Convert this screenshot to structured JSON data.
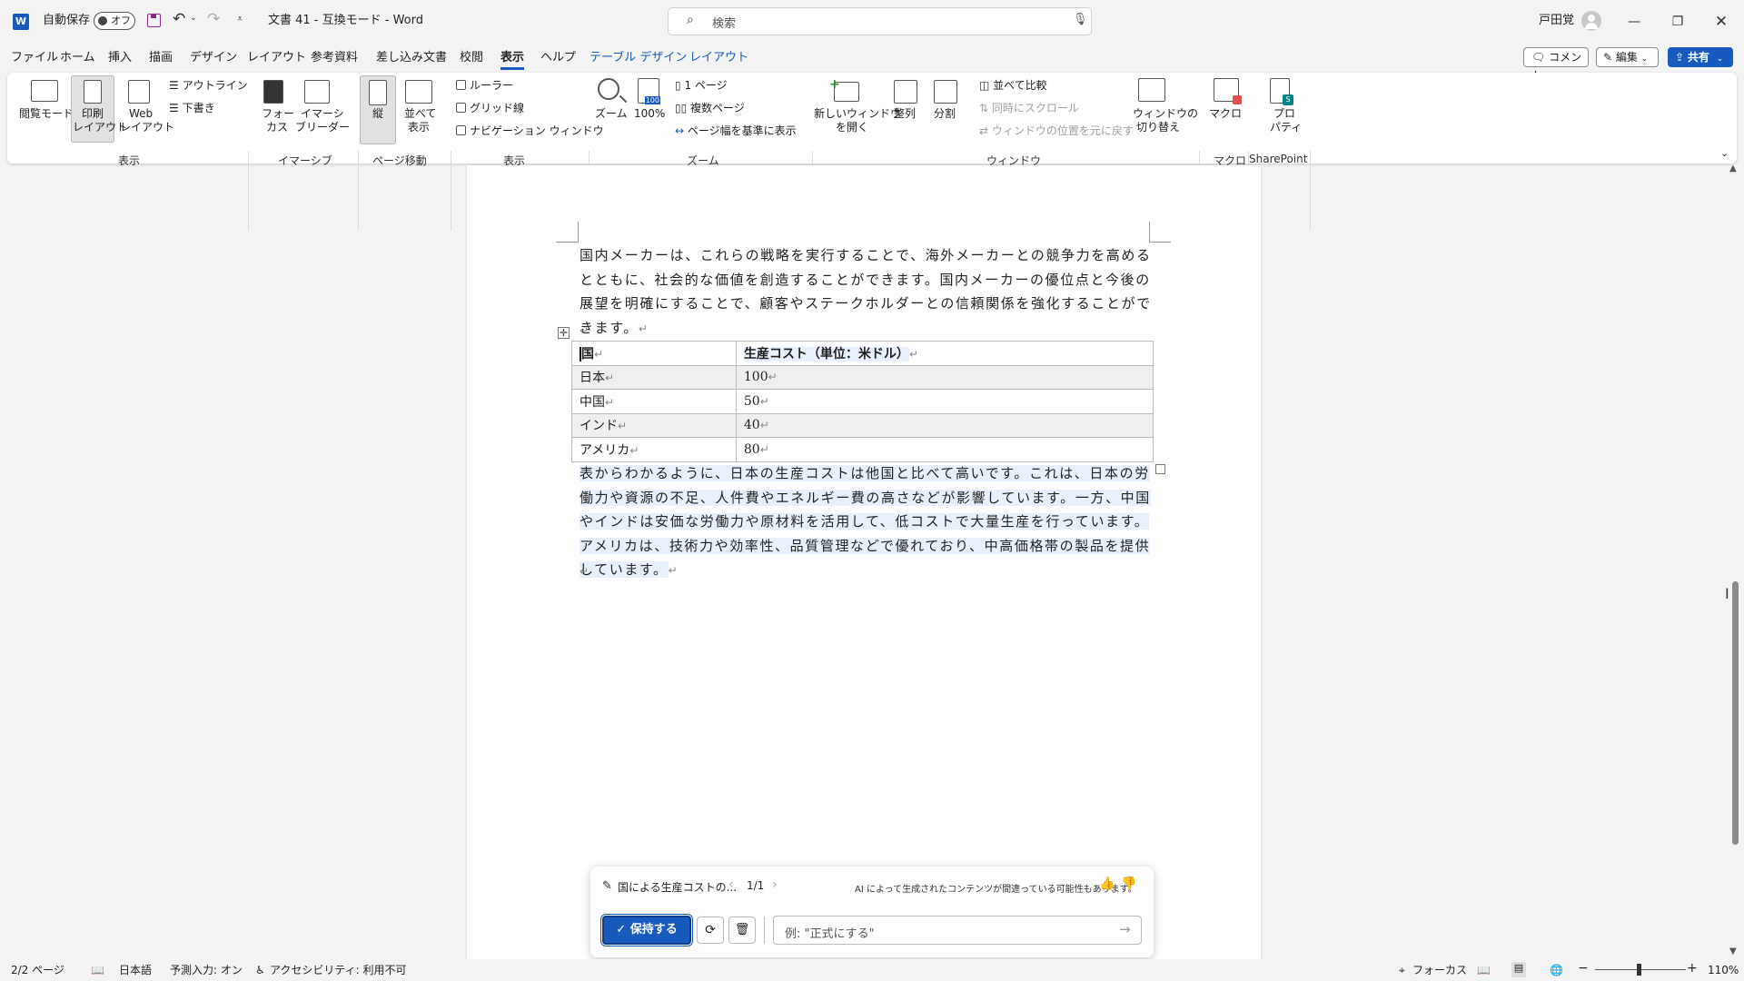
{
  "titlebar": {
    "autosave_label": "自動保存",
    "autosave_state": "オフ",
    "doc_title": "文書 41 - 互換モード - Word",
    "search_placeholder": "検索",
    "user_name": "戸田覚"
  },
  "menu": {
    "tabs": [
      "ファイル",
      "ホーム",
      "挿入",
      "描画",
      "デザイン",
      "レイアウト",
      "参考資料",
      "差し込み文書",
      "校閲",
      "表示",
      "ヘルプ",
      "テーブル デザイン",
      "レイアウト"
    ],
    "selected": "表示",
    "comment_label": "コメント",
    "edit_label": "編集",
    "share_label": "共有"
  },
  "ribbon": {
    "view_group": {
      "read_mode": "閲覧モード",
      "print_layout_1": "印刷",
      "print_layout_2": "レイアウト",
      "web_layout_1": "Web",
      "web_layout_2": "レイアウト",
      "outline": "アウトライン",
      "draft": "下書き",
      "label": "表示"
    },
    "immersive_group": {
      "focus_1": "フォー",
      "focus_2": "カス",
      "reader_1": "イマーシ",
      "reader_2": "ブリーダー",
      "label": "イマーシブ"
    },
    "page_move_group": {
      "vertical": "縦",
      "side_1": "並べて",
      "side_2": "表示",
      "label": "ページ移動"
    },
    "show_group": {
      "ruler": "ルーラー",
      "gridlines": "グリッド線",
      "nav_pane": "ナビゲーション ウィンドウ",
      "label": "表示"
    },
    "zoom_group": {
      "zoom": "ズーム",
      "zoom100": "100%",
      "one_page": "1 ページ",
      "multi_page": "複数ページ",
      "page_width": "ページ幅を基準に表示",
      "label": "ズーム"
    },
    "window_group": {
      "new_window_1": "新しいウィンドウ",
      "new_window_2": "を開く",
      "arrange": "整列",
      "split": "分割",
      "side_by_side": "並べて比較",
      "sync_scroll": "同時にスクロール",
      "reset_pos": "ウィンドウの位置を元に戻す",
      "switch_1": "ウィンドウの",
      "switch_2": "切り替え",
      "label": "ウィンドウ"
    },
    "macro_group": {
      "macro": "マクロ",
      "label": "マクロ"
    },
    "sharepoint_group": {
      "props_1": "プロ",
      "props_2": "パティ",
      "label": "SharePoint"
    }
  },
  "document": {
    "para1": "国内メーカーは、これらの戦略を実行することで、海外メーカーとの競争力を高めるとともに、社会的な価値を創造することができます。国内メーカーの優位点と今後の展望を明確にすることで、顧客やステークホルダーとの信頼関係を強化することができます。",
    "table": {
      "headers": [
        "国",
        "生産コスト（単位：米ドル）"
      ],
      "rows": [
        [
          "日本",
          "100"
        ],
        [
          "中国",
          "50"
        ],
        [
          "インド",
          "40"
        ],
        [
          "アメリカ",
          "80"
        ]
      ]
    },
    "para2": "表からわかるように、日本の生産コストは他国と比べて高いです。これは、日本の労働力や資源の不足、人件費やエネルギー費の高さなどが影響しています。一方、中国やインドは安価な労働力や原材料を活用して、低コストで大量生産を行っています。アメリカは、技術力や効率性、品質管理などで優れており、中高価格帯の製品を提供しています。",
    "para_mark": "↵"
  },
  "ai_panel": {
    "title": "国による生産コストの...",
    "pager": "1/1",
    "disclaimer": "AI によって生成されたコンテンツが間違っている可能性もあります。",
    "keep_label": "保持する",
    "input_placeholder": "例: \"正式にする\""
  },
  "status": {
    "page": "2/2 ページ",
    "language": "日本語",
    "predictive": "予測入力: オン",
    "accessibility": "アクセシビリティ: 利用不可",
    "focus": "フォーカス",
    "zoom": "110%"
  },
  "colors": {
    "accent": "#185abd",
    "word_blue": "#185abd",
    "sharepoint": "#038387"
  }
}
